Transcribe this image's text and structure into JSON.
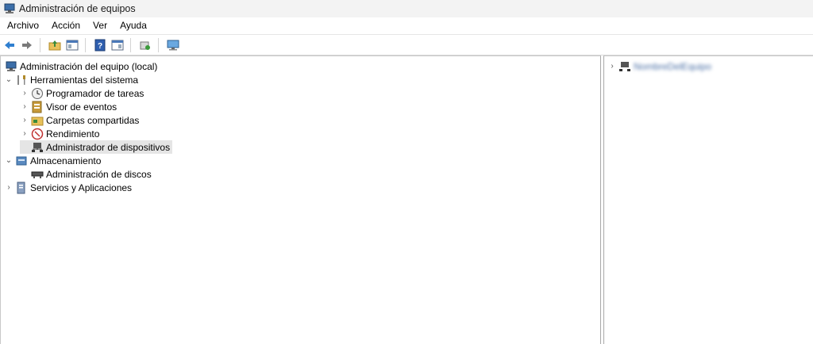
{
  "window": {
    "title": "Administración de equipos"
  },
  "menu": [
    "Archivo",
    "Acción",
    "Ver",
    "Ayuda"
  ],
  "toolbar": {
    "buttons": [
      "back-icon",
      "forward-icon",
      "up-folder-icon",
      "show-hide-tree-icon",
      "help-icon",
      "properties-pane-icon",
      "export-icon",
      "console-icon"
    ]
  },
  "tree": {
    "root": "Administración del equipo (local)",
    "system_tools": "Herramientas del sistema",
    "task_scheduler": "Programador de tareas",
    "event_viewer": "Visor de eventos",
    "shared_folders": "Carpetas compartidas",
    "performance": "Rendimiento",
    "device_manager": "Administrador de dispositivos",
    "storage": "Almacenamiento",
    "disk_management": "Administración de discos",
    "services_apps": "Servicios y Aplicaciones"
  },
  "right": {
    "computer_name": "NombreDelEquipo"
  },
  "colors": {
    "selection": "#e5e5e5",
    "titlebar": "#f3f3f3",
    "accent": "#2f7fd0"
  }
}
